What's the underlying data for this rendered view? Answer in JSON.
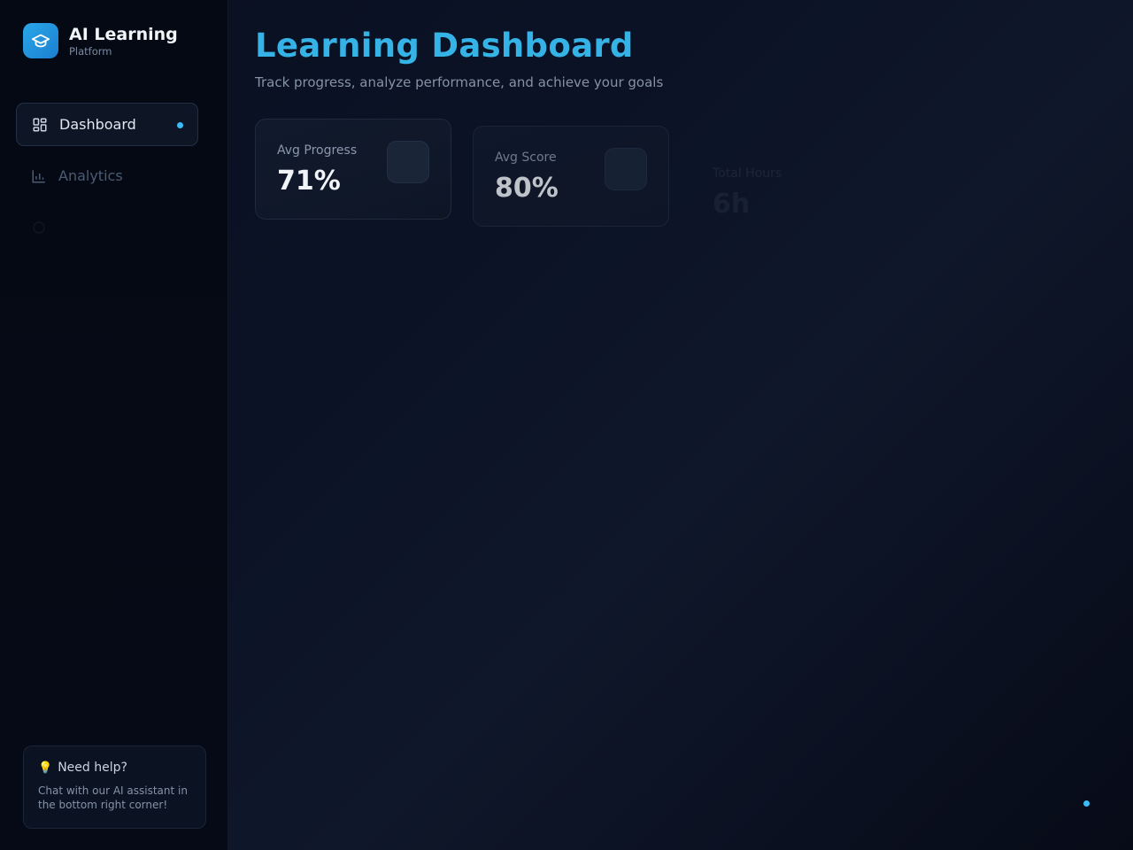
{
  "brand": {
    "title": "AI Learning",
    "subtitle": "Platform",
    "icon": "graduation-cap-icon"
  },
  "sidebar": {
    "items": [
      {
        "label": "Dashboard",
        "icon": "dashboard-grid-icon",
        "active": true
      },
      {
        "label": "Analytics",
        "icon": "bar-chart-icon",
        "active": false
      },
      {
        "label": "",
        "icon": "item-icon",
        "active": false
      }
    ]
  },
  "help": {
    "title": "Need help?",
    "icon": "lightbulb-icon",
    "text": "Chat with our AI assistant in the bottom right corner!"
  },
  "header": {
    "title": "Learning Dashboard",
    "subtitle": "Track progress, analyze performance, and achieve your goals"
  },
  "stats": [
    {
      "label": "Avg Progress",
      "value": "71%"
    },
    {
      "label": "Avg Score",
      "value": "80%"
    },
    {
      "label": "Total Hours",
      "value": "6h"
    }
  ],
  "colors": {
    "accent": "#38bdf8",
    "title": "#36b3e6",
    "background": "#0b1226"
  }
}
